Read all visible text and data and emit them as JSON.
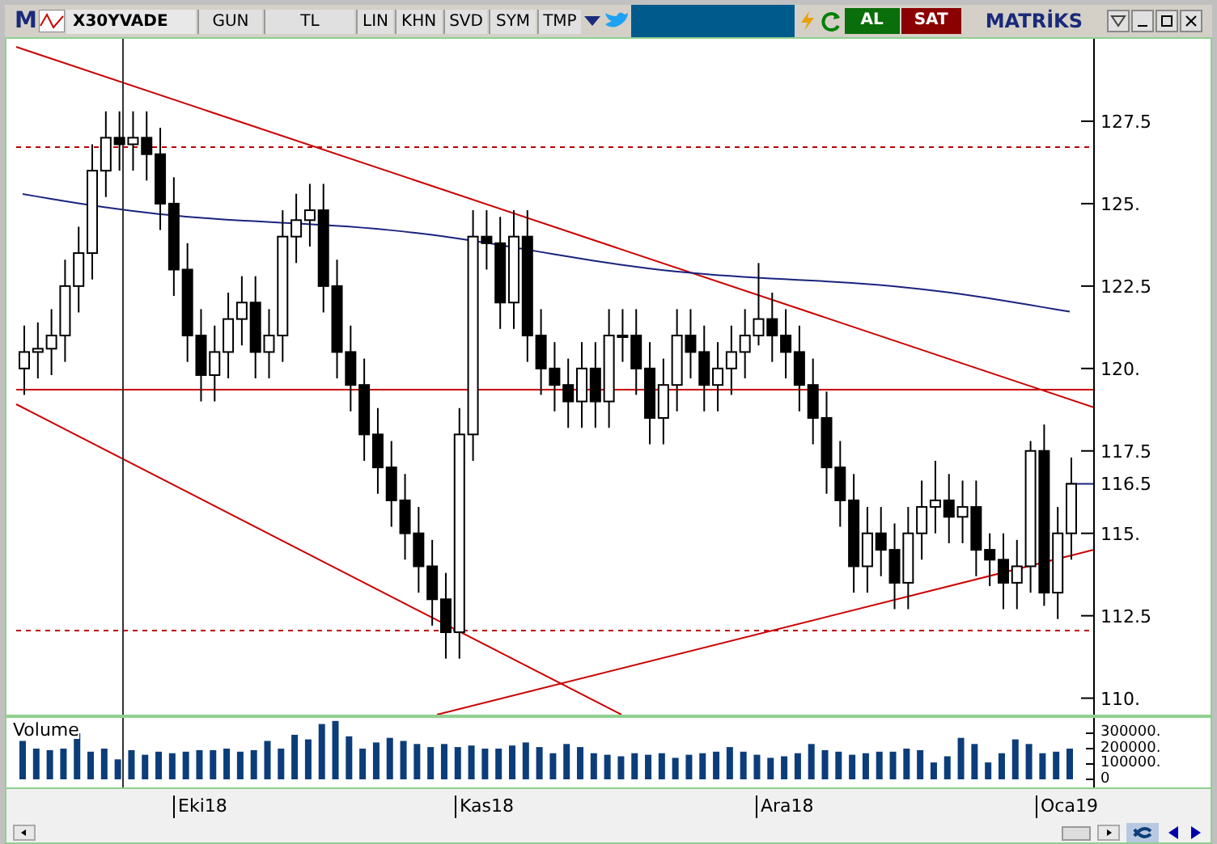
{
  "toolbar": {
    "logo": "M",
    "symbol": "X30YVADE",
    "buttons": [
      {
        "label": "GUN"
      },
      {
        "label": "TL"
      },
      {
        "label": "LIN"
      },
      {
        "label": "KHN"
      },
      {
        "label": "SVD"
      },
      {
        "label": "SYM"
      },
      {
        "label": "TMP"
      }
    ],
    "buy": "AL",
    "sell": "SAT",
    "brand": "MATRİKS"
  },
  "price_chart": {
    "last_price": "116.5",
    "chart_data": {
      "type": "candlestick",
      "ylim": [
        109.5,
        130
      ],
      "yticks": [
        {
          "value": 127.5,
          "label": "127.5"
        },
        {
          "value": 125,
          "label": "125."
        },
        {
          "value": 122.5,
          "label": "122.5"
        },
        {
          "value": 120,
          "label": "120."
        },
        {
          "value": 117.5,
          "label": "117.5"
        },
        {
          "value": 115,
          "label": "115."
        },
        {
          "value": 112.5,
          "label": "112.5"
        },
        {
          "value": 110,
          "label": "110."
        }
      ],
      "ohlc": [
        [
          120,
          121.3,
          119.2,
          120.5
        ],
        [
          120.5,
          121.4,
          119.7,
          120.6
        ],
        [
          120.6,
          121.8,
          119.8,
          121
        ],
        [
          121,
          123.3,
          120.2,
          122.5
        ],
        [
          122.5,
          124.3,
          121.7,
          123.5
        ],
        [
          123.5,
          126.8,
          122.7,
          126
        ],
        [
          126,
          127.8,
          125.2,
          127
        ],
        [
          127,
          127.8,
          126,
          126.8
        ],
        [
          126.8,
          127.8,
          126,
          127
        ],
        [
          127,
          127.8,
          125.7,
          126.5
        ],
        [
          126.5,
          127.3,
          124.2,
          125
        ],
        [
          125,
          125.8,
          122.2,
          123
        ],
        [
          123,
          123.8,
          120.2,
          121
        ],
        [
          121,
          121.8,
          119,
          119.8
        ],
        [
          119.8,
          121.3,
          119,
          120.5
        ],
        [
          120.5,
          122.3,
          119.7,
          121.5
        ],
        [
          121.5,
          122.8,
          120.7,
          122
        ],
        [
          122,
          122.8,
          119.7,
          120.5
        ],
        [
          120.5,
          121.8,
          119.7,
          121
        ],
        [
          121,
          124.8,
          120.2,
          124
        ],
        [
          124,
          125.3,
          123.2,
          124.5
        ],
        [
          124.5,
          125.6,
          123.7,
          124.8
        ],
        [
          124.8,
          125.6,
          121.7,
          122.5
        ],
        [
          122.5,
          123.3,
          119.7,
          120.5
        ],
        [
          120.5,
          121.3,
          118.7,
          119.5
        ],
        [
          119.5,
          120.3,
          117.2,
          118
        ],
        [
          118,
          118.8,
          116.2,
          117
        ],
        [
          117,
          117.8,
          115.2,
          116
        ],
        [
          116,
          116.8,
          114.2,
          115
        ],
        [
          115,
          115.8,
          113.2,
          114
        ],
        [
          114,
          114.8,
          112.2,
          113
        ],
        [
          113,
          113.8,
          111.2,
          112
        ],
        [
          112,
          118.8,
          111.2,
          118
        ],
        [
          118,
          124.8,
          117.2,
          124
        ],
        [
          124,
          124.8,
          123,
          123.8
        ],
        [
          123.8,
          124.6,
          121.2,
          122
        ],
        [
          122,
          124.8,
          121.2,
          124
        ],
        [
          124,
          124.8,
          120.2,
          121
        ],
        [
          121,
          121.8,
          119.2,
          120
        ],
        [
          120,
          120.8,
          118.7,
          119.5
        ],
        [
          119.5,
          120.3,
          118.2,
          119
        ],
        [
          119,
          120.8,
          118.2,
          120
        ],
        [
          120,
          120.8,
          118.2,
          119
        ],
        [
          119,
          121.8,
          118.2,
          121
        ],
        [
          121,
          121.8,
          120.2,
          121
        ],
        [
          121,
          121.8,
          119.2,
          120
        ],
        [
          120,
          120.8,
          117.7,
          118.5
        ],
        [
          118.5,
          120.3,
          117.7,
          119.5
        ],
        [
          119.5,
          121.8,
          118.7,
          121
        ],
        [
          121,
          121.8,
          119.7,
          120.5
        ],
        [
          120.5,
          121.3,
          118.7,
          119.5
        ],
        [
          119.5,
          120.8,
          118.7,
          120
        ],
        [
          120,
          121.3,
          119.2,
          120.5
        ],
        [
          120.5,
          121.8,
          119.7,
          121
        ],
        [
          121,
          123.2,
          120.7,
          121.5
        ],
        [
          121.5,
          122.3,
          120.2,
          121
        ],
        [
          121,
          121.8,
          119.7,
          120.5
        ],
        [
          120.5,
          121.3,
          118.7,
          119.5
        ],
        [
          119.5,
          120.3,
          117.7,
          118.5
        ],
        [
          118.5,
          119.3,
          116.2,
          117
        ],
        [
          117,
          117.8,
          115.2,
          116
        ],
        [
          116,
          116.8,
          113.2,
          114
        ],
        [
          114,
          115.8,
          113.2,
          115
        ],
        [
          115,
          115.8,
          113.7,
          114.5
        ],
        [
          114.5,
          115.3,
          112.7,
          113.5
        ],
        [
          113.5,
          115.8,
          112.7,
          115
        ],
        [
          115,
          116.6,
          114.2,
          115.8
        ],
        [
          115.8,
          117.2,
          115,
          116
        ],
        [
          116,
          116.8,
          114.7,
          115.5
        ],
        [
          115.5,
          116.6,
          114.7,
          115.8
        ],
        [
          115.8,
          116.6,
          113.7,
          114.5
        ],
        [
          114.5,
          115,
          113.4,
          114.2
        ],
        [
          114.2,
          115,
          112.7,
          113.5
        ],
        [
          113.5,
          114.8,
          112.7,
          114
        ],
        [
          114,
          117.8,
          113.2,
          117.5
        ],
        [
          117.5,
          118.3,
          112.8,
          113.2
        ],
        [
          113.2,
          115.8,
          112.4,
          115
        ],
        [
          115,
          117.3,
          114.2,
          116.5
        ]
      ]
    }
  },
  "volume": {
    "title": "Volume",
    "chart_data": {
      "type": "bar",
      "ylim": [
        0,
        400000
      ],
      "yticks": [
        {
          "value": 300000,
          "label": "300000."
        },
        {
          "value": 200000,
          "label": "200000."
        },
        {
          "value": 100000,
          "label": "100000."
        },
        {
          "value": 0,
          "label": "0"
        }
      ],
      "values": [
        250000,
        200000,
        190000,
        200000,
        300000,
        180000,
        200000,
        130000,
        190000,
        160000,
        180000,
        170000,
        180000,
        190000,
        190000,
        200000,
        180000,
        190000,
        250000,
        200000,
        290000,
        260000,
        360000,
        380000,
        280000,
        200000,
        240000,
        270000,
        250000,
        230000,
        210000,
        230000,
        210000,
        220000,
        200000,
        200000,
        220000,
        240000,
        210000,
        170000,
        230000,
        210000,
        170000,
        160000,
        150000,
        170000,
        160000,
        170000,
        140000,
        160000,
        170000,
        180000,
        210000,
        180000,
        160000,
        140000,
        150000,
        170000,
        230000,
        190000,
        180000,
        160000,
        170000,
        180000,
        180000,
        200000,
        190000,
        110000,
        150000,
        270000,
        230000,
        110000,
        170000,
        260000,
        230000,
        170000,
        180000,
        200000
      ]
    }
  },
  "date_axis": {
    "labels": [
      "Eki18",
      "Kas18",
      "Ara18",
      "Oca19"
    ]
  }
}
